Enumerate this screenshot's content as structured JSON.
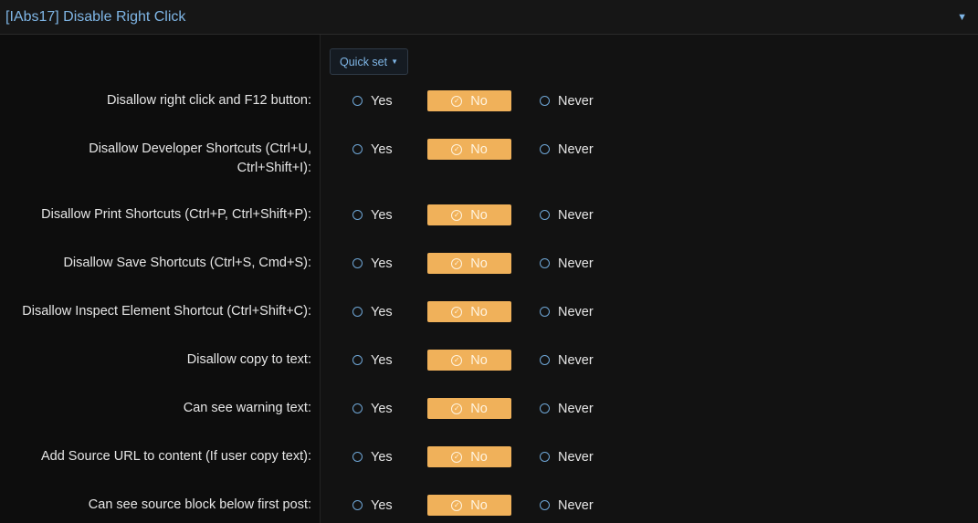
{
  "header": {
    "title": "[IAbs17] Disable Right Click",
    "caret_icon": "caret-down-icon"
  },
  "quickset": {
    "label": "Quick set"
  },
  "options": {
    "yes": "Yes",
    "no": "No",
    "never": "Never"
  },
  "colors": {
    "accent": "#7fb6e6",
    "selected": "#f0b15a",
    "background": "#0d0d0d"
  },
  "settings": [
    {
      "label_lines": [
        "Disallow right click and F12 button:"
      ],
      "selected": "no"
    },
    {
      "label_lines": [
        "Disallow Developer Shortcuts (Ctrl+U,",
        "Ctrl+Shift+I):"
      ],
      "selected": "no"
    },
    {
      "label_lines": [
        "Disallow Print Shortcuts (Ctrl+P, Ctrl+Shift+P):"
      ],
      "selected": "no"
    },
    {
      "label_lines": [
        "Disallow Save Shortcuts (Ctrl+S, Cmd+S):"
      ],
      "selected": "no"
    },
    {
      "label_lines": [
        "Disallow Inspect Element Shortcut (Ctrl+Shift+C):"
      ],
      "selected": "no"
    },
    {
      "label_lines": [
        "Disallow copy to text:"
      ],
      "selected": "no"
    },
    {
      "label_lines": [
        "Can see warning text:"
      ],
      "selected": "no"
    },
    {
      "label_lines": [
        "Add Source URL to content (If user copy text):"
      ],
      "selected": "no"
    },
    {
      "label_lines": [
        "Can see source block below first post:"
      ],
      "selected": "no"
    }
  ]
}
